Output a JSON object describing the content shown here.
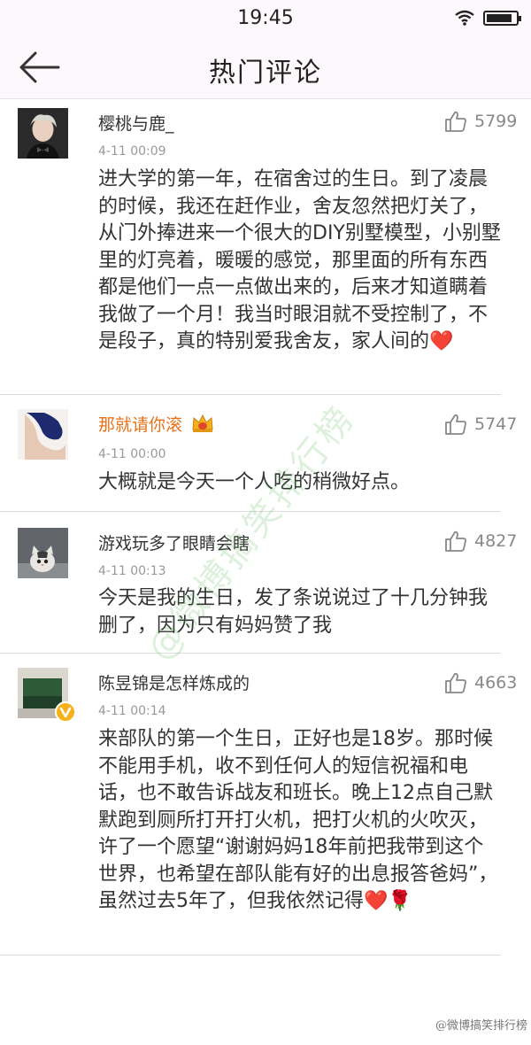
{
  "status_bar": {
    "time": "19:45",
    "wifi_icon": "wifi-icon",
    "battery_icon": "battery-icon"
  },
  "nav": {
    "back_icon": "arrow-left-icon",
    "title": "热门评论"
  },
  "comments": [
    {
      "username": "樱桃与鹿_",
      "time": "4-11 00:09",
      "likes": "5799",
      "text": "进大学的第一年，在宿舍过的生日。到了凌晨的时候，我还在赶作业，舍友忽然把灯关了，从门外捧进来一个很大的DIY别墅模型，小别墅里的灯亮着，暖暖的感觉，那里面的所有东西都是他们一点一点做出来的，后来才知道瞒着我做了一个月！我当时眼泪就不受控制了，不是段子，真的特别爱我舍友，家人间的",
      "text_end_emoji": "❤️",
      "avatar_icon": "user-avatar"
    },
    {
      "username": "那就请你滚",
      "time": "4-11 00:00",
      "likes": "5747",
      "text": "大概就是今天一个人吃的稍微好点。",
      "badge_icon": "crown-vip-icon",
      "name_color": "#e8731a",
      "avatar_icon": "user-avatar"
    },
    {
      "username": "游戏玩多了眼睛会瞎",
      "time": "4-11 00:13",
      "likes": "4827",
      "text": "今天是我的生日，发了条说说过了十几分钟我删了，因为只有妈妈赞了我",
      "avatar_icon": "cat-avatar"
    },
    {
      "username": "陈昱锦是怎样炼成的",
      "time": "4-11 00:14",
      "likes": "4663",
      "text": "来部队的第一个生日，正好也是18岁。那时候不能用手机，收不到任何人的短信祝福和电话，也不敢告诉战友和班长。晚上12点自己默默跑到厕所打开打火机，把打火机的火吹灭，许了一个愿望“谢谢妈妈18年前把我带到这个世界，也希望在部队能有好的出息报答爸妈”，虽然过去5年了，但我依然记得",
      "text_end_emoji": "❤️🌹",
      "verified_icon": "verified-v-icon",
      "avatar_icon": "user-avatar"
    }
  ],
  "watermark": {
    "diagonal": "@微博搞笑排行榜",
    "bottom": "@微博搞笑排行榜"
  }
}
